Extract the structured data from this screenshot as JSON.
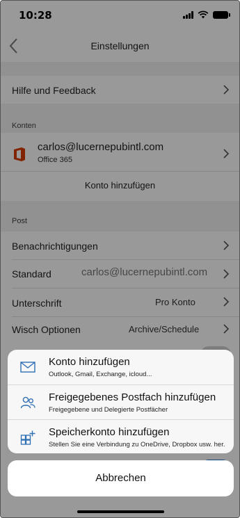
{
  "status_bar": {
    "time": "10:28"
  },
  "nav": {
    "title": "Einstellungen"
  },
  "settings": {
    "help_feedback": "Hilfe und Feedback",
    "accounts_header": "Konten",
    "account": {
      "email": "carlos@lucernepubintl.com",
      "type": "Office 365"
    },
    "add_account": "Konto hinzufügen",
    "mail_header": "Post",
    "rows": [
      {
        "label": "Benachrichtigungen",
        "value": ""
      },
      {
        "label": "Standard",
        "value": "carlos@lucernepubintl.com"
      },
      {
        "label": "Unterschrift",
        "value": "Pro Konto"
      },
      {
        "label": "Wisch Optionen",
        "value": "Archive/Schedule"
      }
    ]
  },
  "action_sheet": {
    "items": [
      {
        "title": "Konto hinzufügen",
        "subtitle": "Outlook, Gmail, Exchange, icloud...",
        "icon": "envelope-icon"
      },
      {
        "title": "Freigegebenes Postfach hinzufügen",
        "subtitle": "Freigegebene und Delegierte Postfächer",
        "icon": "people-icon"
      },
      {
        "title": "Speicherkonto hinzufügen",
        "subtitle": "Stellen Sie eine Verbindung zu OneDrive, Dropbox usw. her.",
        "icon": "storage-grid-icon"
      }
    ],
    "cancel": "Abbrechen"
  },
  "colors": {
    "accent": "#1a73c9",
    "office_red": "#d83b01",
    "sheet_icon": "#2f6fb3"
  }
}
